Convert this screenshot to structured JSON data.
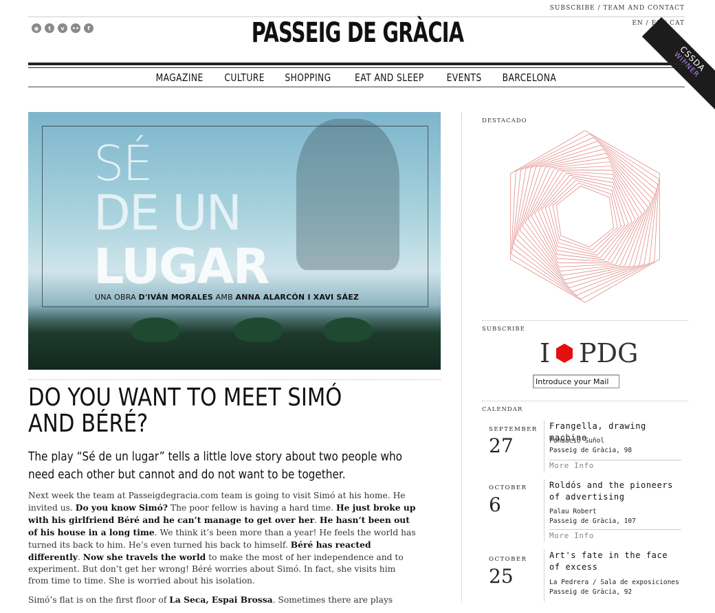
{
  "header": {
    "toplinks": {
      "subscribe": "SUBSCRIBE",
      "sep": " / ",
      "team": "TEAM AND CONTACT"
    },
    "social_icons": [
      "rss-icon",
      "twitter-icon",
      "vimeo-icon",
      "flickr-icon",
      "facebook-icon"
    ],
    "social_glyphs": [
      "◉",
      "t",
      "v",
      "••",
      "f"
    ],
    "logo": "PASSEIG DE GRÀCIA",
    "langs": [
      "EN",
      "ES",
      "CAT"
    ],
    "lang_sep": " / ",
    "ribbon": {
      "top": "CSSDA",
      "bottom": "WINNER"
    }
  },
  "nav": [
    "MAGAZINE",
    "CULTURE",
    "SHOPPING",
    "EAT AND SLEEP",
    "EVENTS",
    "BARCELONA"
  ],
  "hero": {
    "line1": "SÉ",
    "line2": "DE UN",
    "line3": "LUGAR",
    "credit_prefix": "UNA OBRA ",
    "credit_author": "D'IVÁN MORALES",
    "credit_mid": " AMB ",
    "credit_cast": "ANNA ALARCÓN I XAVI SÁEZ"
  },
  "article": {
    "title": "DO YOU WANT TO MEET SIMÓ AND BÉRÉ?",
    "subtitle": "The play “Sé de un lugar” tells a little love story about two people who need each other but cannot and do not want to be together.",
    "p1": [
      "Next week the team at Passeigdegracia.com team is going to visit Simó at his home. He invited us. ",
      "Do you know Simó?",
      " The poor fellow is having a hard time. ",
      "He just broke up with his girlfriend Béré and he can’t manage to get over her",
      ". ",
      "He hasn’t been out of his house in a long time",
      ". We think it’s been more than a year! He feels the world has turned its back to him. He’s even turned his back to himself. ",
      "Béré has reacted differently",
      ". ",
      "Now she travels the world",
      " to make the most of her independence and to experiment. But don’t get her wrong! Béré worries about Simó. In fact, she visits him from time to time. She is worried about his isolation."
    ],
    "p2": [
      "Simó’s flat is on the first floor of ",
      "La Seca, Espai Brossa",
      ". Sometimes there are plays"
    ]
  },
  "sidebar": {
    "destacado": "DESTACADO",
    "subscribe": "SUBSCRIBE",
    "ipdg_i": "I",
    "ipdg_pdg": "PDG",
    "mail_value": "Introduce your Mail",
    "calendar": "CALENDAR",
    "accent": "#e3100f",
    "events": [
      {
        "month": "SEPTEMBER",
        "day": "27",
        "name": "Frangella, drawing machine",
        "place1": "Fundació Suñol",
        "place2": "Passeig de Gràcia, 98",
        "more": "More Info"
      },
      {
        "month": "OCTOBER",
        "day": "6",
        "name": "Roldós and the pioneers of advertising",
        "place1": "Palau Robert",
        "place2": "Passeig de Gràcia, 107",
        "more": "More Info"
      },
      {
        "month": "OCTOBER",
        "day": "25",
        "name": "Art's fate in the face of excess",
        "place1": "La Pedrera / Sala de exposiciones",
        "place2": "Passeig de Gràcia, 92",
        "more": ""
      }
    ]
  }
}
